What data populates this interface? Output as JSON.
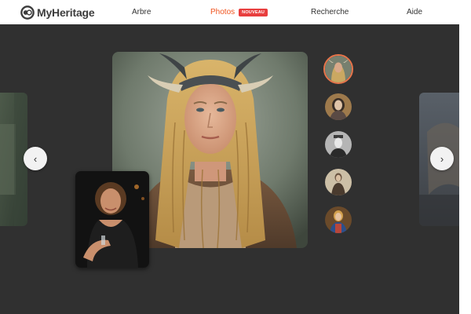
{
  "header": {
    "logo_text": "MyHeritage",
    "nav": {
      "arbre": "Arbre",
      "photos": "Photos",
      "photos_badge": "NOUVEAU",
      "recherche": "Recherche",
      "aide": "Aide"
    }
  },
  "carousel": {
    "prev_symbol": "‹",
    "next_symbol": "›",
    "thumbnail_count": 5,
    "active_thumbnail": 1
  },
  "colors": {
    "accent": "#f0541e",
    "badge": "#e83e3e",
    "stage_background": "#303030",
    "active_ring": "#e8744a"
  }
}
